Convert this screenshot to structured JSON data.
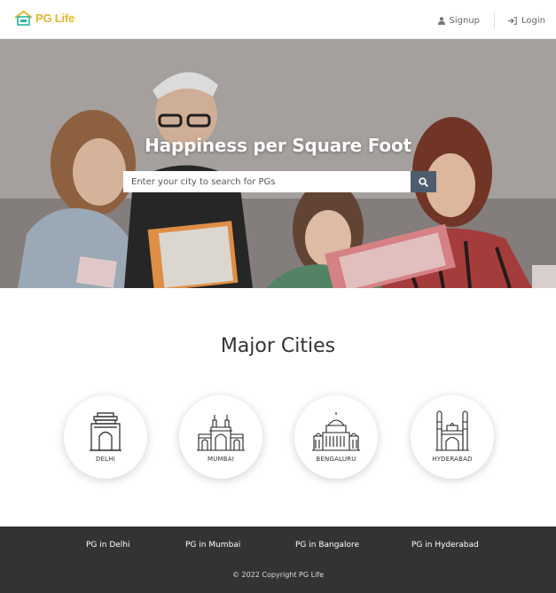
{
  "header": {
    "logo_text": "PG Life",
    "signup_label": "Signup",
    "login_label": "Login"
  },
  "hero": {
    "title": "Happiness per Square Foot",
    "search_placeholder": "Enter your city to search for PGs"
  },
  "cities_section": {
    "title": "Major Cities",
    "cities": [
      {
        "label": "DELHI",
        "icon": "india-gate-icon"
      },
      {
        "label": "MUMBAI",
        "icon": "gateway-of-india-icon"
      },
      {
        "label": "BENGALURU",
        "icon": "vidhana-soudha-icon"
      },
      {
        "label": "HYDERABAD",
        "icon": "charminar-icon"
      }
    ]
  },
  "footer": {
    "links": [
      "PG in Delhi",
      "PG in Mumbai",
      "PG in Bangalore",
      "PG in Hyderabad"
    ],
    "copyright": "© 2022 Copyright PG Life"
  },
  "colors": {
    "brand": "#e5b52a",
    "logo_roof": "#2bb3a3",
    "search_button": "#4e5d6e",
    "footer_bg": "#333333"
  }
}
